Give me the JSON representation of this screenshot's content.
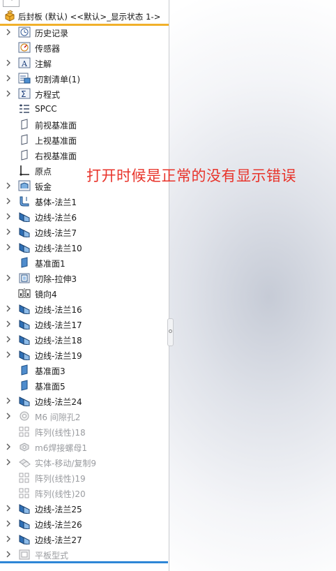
{
  "root": {
    "label": "后封板 (默认) <<默认>_显示状态 1->"
  },
  "annotation": "打开时候是正常的没有显示错误",
  "colors": {
    "accent_orange": "#f1b02a",
    "bottom_bar": "#2e86d6",
    "annotation": "#e8332a",
    "disabled_text": "#9a9ca0"
  },
  "tree": [
    {
      "label": "历史记录",
      "icon": "history-icon",
      "expand": true,
      "dim": false
    },
    {
      "label": "传感器",
      "icon": "sensor-icon",
      "expand": false,
      "dim": false
    },
    {
      "label": "注解",
      "icon": "annotation-icon",
      "expand": true,
      "dim": false
    },
    {
      "label": "切割清单(1)",
      "icon": "cut-list-icon",
      "expand": true,
      "dim": false
    },
    {
      "label": "方程式",
      "icon": "equations-icon",
      "expand": true,
      "dim": false
    },
    {
      "label": "SPCC",
      "icon": "material-icon",
      "expand": false,
      "dim": false
    },
    {
      "label": "前视基准面",
      "icon": "plane-icon",
      "expand": false,
      "dim": false
    },
    {
      "label": "上视基准面",
      "icon": "plane-icon",
      "expand": false,
      "dim": false
    },
    {
      "label": "右视基准面",
      "icon": "plane-icon",
      "expand": false,
      "dim": false
    },
    {
      "label": "原点",
      "icon": "origin-icon",
      "expand": false,
      "dim": false
    },
    {
      "label": "钣金",
      "icon": "sheet-metal-icon",
      "expand": true,
      "dim": false
    },
    {
      "label": "基体-法兰1",
      "icon": "base-flange-icon",
      "expand": true,
      "dim": false
    },
    {
      "label": "边线-法兰6",
      "icon": "edge-flange-icon",
      "expand": true,
      "dim": false
    },
    {
      "label": "边线-法兰7",
      "icon": "edge-flange-icon",
      "expand": true,
      "dim": false
    },
    {
      "label": "边线-法兰10",
      "icon": "edge-flange-icon",
      "expand": true,
      "dim": false
    },
    {
      "label": "基准面1",
      "icon": "ref-plane-icon",
      "expand": false,
      "dim": false
    },
    {
      "label": "切除-拉伸3",
      "icon": "cut-extrude-icon",
      "expand": true,
      "dim": false
    },
    {
      "label": "镜向4",
      "icon": "mirror-icon",
      "expand": false,
      "dim": false
    },
    {
      "label": "边线-法兰16",
      "icon": "edge-flange-icon",
      "expand": true,
      "dim": false
    },
    {
      "label": "边线-法兰17",
      "icon": "edge-flange-icon",
      "expand": true,
      "dim": false
    },
    {
      "label": "边线-法兰18",
      "icon": "edge-flange-icon",
      "expand": true,
      "dim": false
    },
    {
      "label": "边线-法兰19",
      "icon": "edge-flange-icon",
      "expand": true,
      "dim": false
    },
    {
      "label": "基准面3",
      "icon": "ref-plane-icon",
      "expand": false,
      "dim": false
    },
    {
      "label": "基准面5",
      "icon": "ref-plane-icon",
      "expand": false,
      "dim": false
    },
    {
      "label": "边线-法兰24",
      "icon": "edge-flange-icon",
      "expand": true,
      "dim": false
    },
    {
      "label": "M6 间隙孔2",
      "icon": "hole-wizard-icon",
      "expand": true,
      "dim": true
    },
    {
      "label": "阵列(线性)18",
      "icon": "linear-pattern-icon",
      "expand": false,
      "dim": true
    },
    {
      "label": "m6焊接螺母1",
      "icon": "weld-nut-icon",
      "expand": true,
      "dim": true
    },
    {
      "label": "实体-移动/复制9",
      "icon": "move-copy-icon",
      "expand": true,
      "dim": true
    },
    {
      "label": "阵列(线性)19",
      "icon": "linear-pattern-icon",
      "expand": false,
      "dim": true
    },
    {
      "label": "阵列(线性)20",
      "icon": "linear-pattern-icon",
      "expand": false,
      "dim": true
    },
    {
      "label": "边线-法兰25",
      "icon": "edge-flange-icon",
      "expand": true,
      "dim": false
    },
    {
      "label": "边线-法兰26",
      "icon": "edge-flange-icon",
      "expand": true,
      "dim": false
    },
    {
      "label": "边线-法兰27",
      "icon": "edge-flange-icon",
      "expand": true,
      "dim": false
    },
    {
      "label": "平板型式",
      "icon": "flat-pattern-icon",
      "expand": true,
      "dim": true
    }
  ]
}
